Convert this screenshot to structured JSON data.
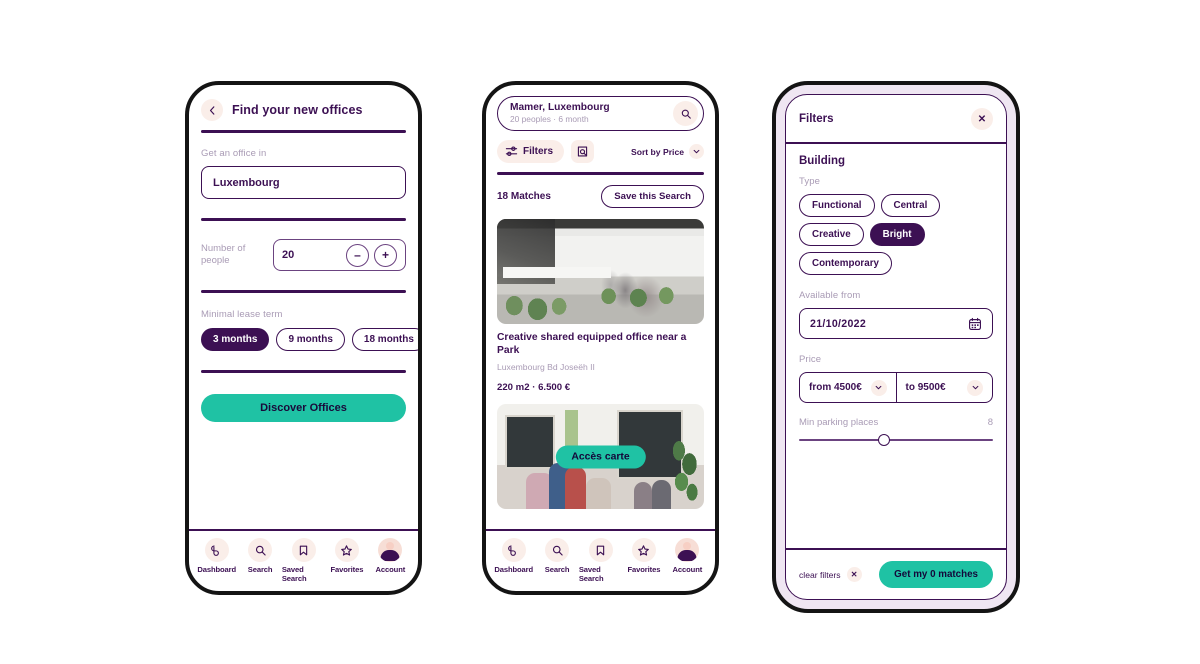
{
  "theme": {
    "purple": "#3c1053",
    "teal": "#1fc2a4",
    "muted": "#a99bb5",
    "cream": "#faeee9"
  },
  "search_screen": {
    "back_icon": "chevron-left-icon",
    "title": "Find your new offices",
    "location": {
      "label": "Get an office in",
      "value": "Luxembourg"
    },
    "people": {
      "label": "Number of people",
      "value": "20",
      "decrement": "–",
      "increment": "+"
    },
    "lease": {
      "label": "Minimal lease term",
      "options": [
        {
          "label": "3 months",
          "selected": true
        },
        {
          "label": "9 months",
          "selected": false
        },
        {
          "label": "18 months",
          "selected": false
        }
      ]
    },
    "cta": "Discover Offices"
  },
  "results_screen": {
    "search": {
      "query": "Mamer, Luxembourg",
      "details": "20 peoples · 6 month",
      "icon": "search-icon"
    },
    "filters_pill": {
      "label": "Filters",
      "icon": "sliders-icon"
    },
    "saved_search_icon": "saved-search-icon",
    "sort": {
      "label": "Sort by Price",
      "icon": "chevron-down-icon"
    },
    "matches": "18 Matches",
    "save_search": "Save this Search",
    "listings": [
      {
        "title": "Creative shared equipped office near a Park",
        "address": "Luxembourg  Bd Joseëh II",
        "meta": "220 m2  ·  6.500 €",
        "photo_alt": "open-plan-loft-office-photo"
      },
      {
        "map_button": "Accès carte",
        "photo_alt": "bright-coworking-cafe-photo"
      }
    ]
  },
  "filters_screen": {
    "title": "Filters",
    "close_icon": "close-icon",
    "section_title": "Building",
    "type": {
      "label": "Type",
      "options": [
        {
          "label": "Functional",
          "selected": false
        },
        {
          "label": "Central",
          "selected": false
        },
        {
          "label": "Creative",
          "selected": false
        },
        {
          "label": "Bright",
          "selected": true
        },
        {
          "label": "Contemporary",
          "selected": false
        }
      ]
    },
    "available_from": {
      "label": "Available from",
      "value": "21/10/2022",
      "icon": "calendar-icon"
    },
    "price": {
      "label": "Price",
      "from": "from 4500€",
      "to": "to 9500€",
      "icon": "chevron-down-icon"
    },
    "parking": {
      "label": "Min parking places",
      "value": "8",
      "percent": 44
    },
    "clear_filters": "clear filters",
    "submit": "Get my 0 matches"
  },
  "bottom_nav": {
    "items": [
      {
        "label": "Dashboard",
        "icon": "dashboard-icon"
      },
      {
        "label": "Search",
        "icon": "search-icon"
      },
      {
        "label": "Saved Search",
        "icon": "bookmark-icon"
      },
      {
        "label": "Favorites",
        "icon": "star-icon"
      },
      {
        "label": "Account",
        "icon": "avatar-icon"
      }
    ]
  }
}
